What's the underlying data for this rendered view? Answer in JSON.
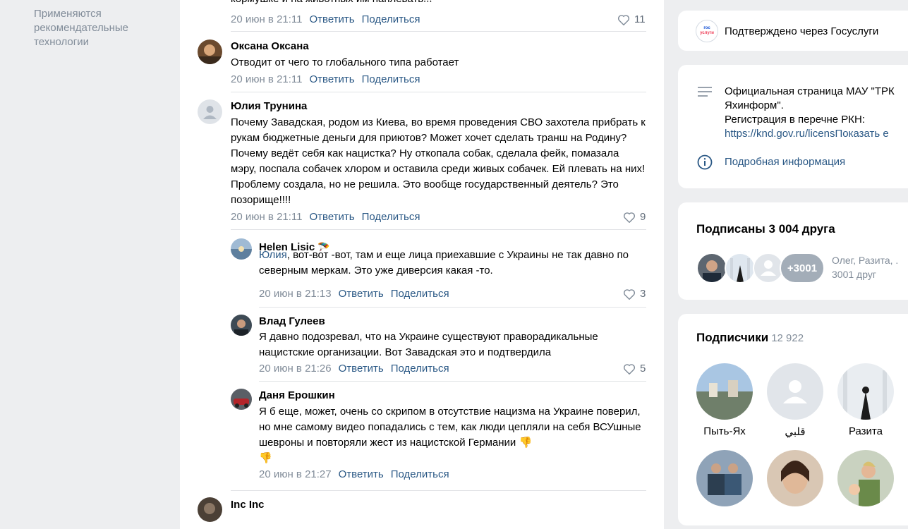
{
  "left_note": "Применяются рекомендательные технологии",
  "feed": {
    "top_partial": {
      "text": "кормушке и на животных им наплевать!!!",
      "date": "20 июн в 21:11",
      "reply": "Ответить",
      "share": "Поделиться",
      "likes": "11"
    },
    "comments": [
      {
        "author": "Оксана Оксана",
        "text": "Отводит от чего то глобального типа работает",
        "date": "20 июн в 21:11",
        "reply": "Ответить",
        "share": "Поделиться"
      },
      {
        "author": "Юлия Трунина",
        "text": "Почему Завадская, родом из Киева, во время проведения СВО захотела прибрать к рукам бюджетные деньги для приютов? Может хочет сделать транш на Родину? Почему ведёт себя как нацистка? Ну откопала собак, сделала фейк, помазала мэру, поспала собачек хлором и оставила среди живых собачек. Ей плевать на них! Проблему создала, но не решила. Это вообще государственный деятель? Это позорище!!!!",
        "date": "20 июн в 21:11",
        "reply": "Ответить",
        "share": "Поделиться",
        "likes": "9"
      }
    ],
    "replies": [
      {
        "author": "Helen Lisic",
        "mention": "Юлия",
        "text": ", вот-вот -вот, там и еще лица приехавшие с Украины не так давно по северным меркам. Это уже диверсия какая -то.",
        "date": "20 июн в 21:13",
        "reply": "Ответить",
        "share": "Поделиться",
        "likes": "3"
      },
      {
        "author": "Влад Гулеев",
        "text": "Я давно подозревал, что на Украине существуют праворадикальные нацистские организации. Вот Завадская это и подтвердила",
        "date": "20 июн в 21:26",
        "reply": "Ответить",
        "share": "Поделиться",
        "likes": "5"
      },
      {
        "author": "Даня Ерошкин",
        "text": "Я б еще, может, очень со скрипом в отсутствие нацизма на Украине поверил, но мне самому видео попадались с тем, как люди цепляли на себя ВСУшные шевроны и повторяли жест из нацистской Германии",
        "emoji": "👎",
        "date": "20 июн в 21:27",
        "reply": "Ответить",
        "share": "Поделиться"
      }
    ],
    "bottom_partial_author": "Inc Inc"
  },
  "right": {
    "gosuslugi": {
      "badge_line1": "гос",
      "badge_line2": "услуги",
      "text": "Подтверждено через Госуслуги"
    },
    "info": {
      "line1": "Официальная страница МАУ \"ТРК",
      "line2": "Яхинформ\".",
      "line3": "Регистрация в перечне РКН:",
      "link": "https://knd.gov.ru/licensПоказать е",
      "details": "Подробная информация"
    },
    "friends": {
      "title": "Подписаны 3 004 друга",
      "more": "+3001",
      "names": "Олег, Разита, .",
      "count": "3001 друг"
    },
    "followers": {
      "title": "Подписчики",
      "count": "12 922",
      "items": [
        {
          "name": "Пыть-Ях"
        },
        {
          "name": "قلبي"
        },
        {
          "name": "Разита"
        }
      ]
    }
  },
  "colors": {
    "accent": "#2a5885",
    "muted": "#818c99",
    "background": "#edeef0"
  }
}
